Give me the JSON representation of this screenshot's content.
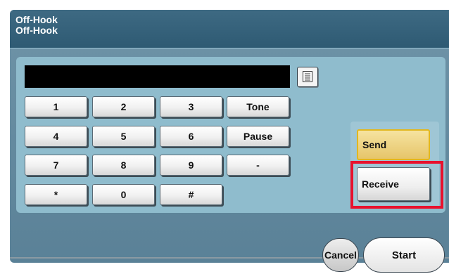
{
  "header": {
    "line1": "Off-Hook",
    "line2": "Off-Hook"
  },
  "display": {
    "value": ""
  },
  "keypad": {
    "rows": [
      [
        "1",
        "2",
        "3",
        "Tone"
      ],
      [
        "4",
        "5",
        "6",
        "Pause"
      ],
      [
        "7",
        "8",
        "9",
        "-"
      ],
      [
        "*",
        "0",
        "#"
      ]
    ]
  },
  "side": {
    "send_label": "Send",
    "receive_label": "Receive"
  },
  "footer": {
    "cancel_label": "Cancel",
    "start_label": "Start"
  },
  "colors": {
    "highlight": "#e8112d",
    "send_border": "#e2b71f",
    "header_bg": "#2e5a73"
  },
  "icons": {
    "list": "list-icon"
  }
}
